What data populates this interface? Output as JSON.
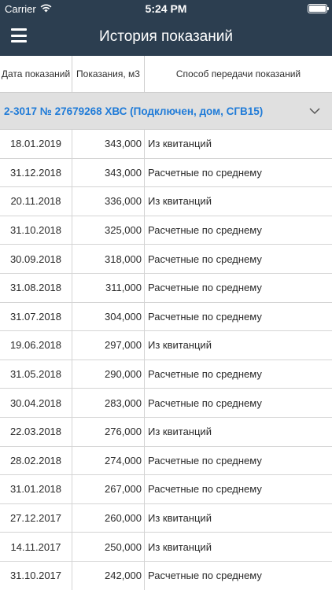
{
  "status_bar": {
    "carrier": "Carrier",
    "time": "5:24 PM",
    "battery_level": 1.0
  },
  "nav": {
    "title": "История показаний",
    "menu_icon": "hamburger-menu-icon"
  },
  "table": {
    "headers": {
      "date": "Дата показаний",
      "value": "Показания, м3",
      "method": "Способ передачи показаний"
    },
    "group": {
      "title": "2-3017 № 27679268 ХВС (Подключен, дом, СГВ15)",
      "icon": "chevron-down-icon"
    },
    "rows": [
      {
        "date": "18.01.2019",
        "value": "343,000",
        "method": "Из квитанций"
      },
      {
        "date": "31.12.2018",
        "value": "343,000",
        "method": "Расчетные по среднему"
      },
      {
        "date": "20.11.2018",
        "value": "336,000",
        "method": "Из квитанций"
      },
      {
        "date": "31.10.2018",
        "value": "325,000",
        "method": "Расчетные по среднему"
      },
      {
        "date": "30.09.2018",
        "value": "318,000",
        "method": "Расчетные по среднему"
      },
      {
        "date": "31.08.2018",
        "value": "311,000",
        "method": "Расчетные по среднему"
      },
      {
        "date": "31.07.2018",
        "value": "304,000",
        "method": "Расчетные по среднему"
      },
      {
        "date": "19.06.2018",
        "value": "297,000",
        "method": "Из квитанций"
      },
      {
        "date": "31.05.2018",
        "value": "290,000",
        "method": "Расчетные по среднему"
      },
      {
        "date": "30.04.2018",
        "value": "283,000",
        "method": "Расчетные по среднему"
      },
      {
        "date": "22.03.2018",
        "value": "276,000",
        "method": "Из квитанций"
      },
      {
        "date": "28.02.2018",
        "value": "274,000",
        "method": "Расчетные по среднему"
      },
      {
        "date": "31.01.2018",
        "value": "267,000",
        "method": "Расчетные по среднему"
      },
      {
        "date": "27.12.2017",
        "value": "260,000",
        "method": "Из квитанций"
      },
      {
        "date": "14.11.2017",
        "value": "250,000",
        "method": "Из квитанций"
      },
      {
        "date": "31.10.2017",
        "value": "242,000",
        "method": "Расчетные по среднему"
      }
    ]
  },
  "colors": {
    "topbar": "#2c3e50",
    "group_bg": "#e0e0e0",
    "group_text": "#1f7bd8"
  }
}
